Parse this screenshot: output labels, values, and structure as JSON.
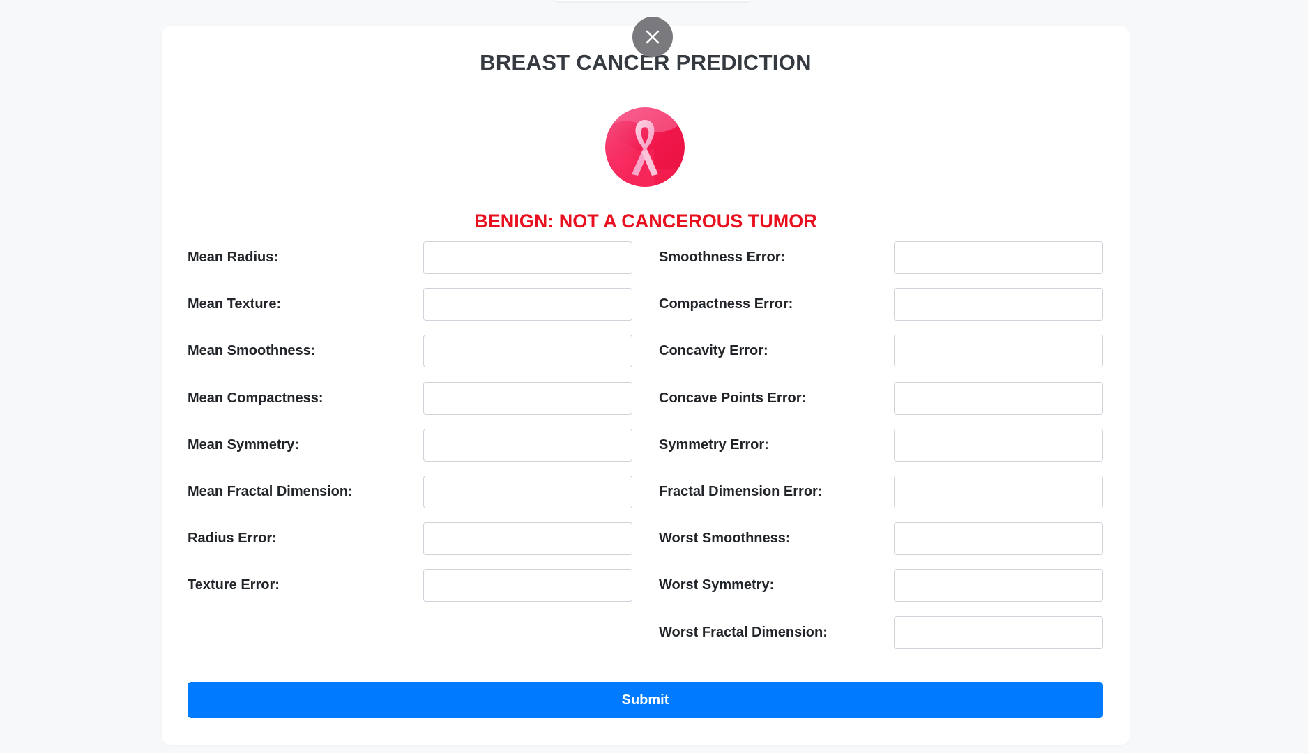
{
  "page": {
    "title": "BREAST CANCER PREDICTION",
    "close_icon": "close-icon",
    "logo_icon": "pink-ribbon-icon"
  },
  "result": {
    "text": "BENIGN: NOT A CANCEROUS TUMOR",
    "color": "#e8101f"
  },
  "form": {
    "left_fields": [
      {
        "label": "Mean Radius:",
        "value": ""
      },
      {
        "label": "Mean Texture:",
        "value": ""
      },
      {
        "label": "Mean Smoothness:",
        "value": ""
      },
      {
        "label": "Mean Compactness:",
        "value": ""
      },
      {
        "label": "Mean Symmetry:",
        "value": ""
      },
      {
        "label": "Mean Fractal Dimension:",
        "value": ""
      },
      {
        "label": "Radius Error:",
        "value": ""
      },
      {
        "label": "Texture Error:",
        "value": ""
      }
    ],
    "right_fields": [
      {
        "label": "Smoothness Error:",
        "value": ""
      },
      {
        "label": "Compactness Error:",
        "value": ""
      },
      {
        "label": "Concavity Error:",
        "value": ""
      },
      {
        "label": "Concave Points Error:",
        "value": ""
      },
      {
        "label": "Symmetry Error:",
        "value": ""
      },
      {
        "label": "Fractal Dimension Error:",
        "value": ""
      },
      {
        "label": "Worst Smoothness:",
        "value": ""
      },
      {
        "label": "Worst Symmetry:",
        "value": ""
      },
      {
        "label": "Worst Fractal Dimension:",
        "value": ""
      }
    ],
    "submit_label": "Submit",
    "accent_color": "#007bff"
  }
}
